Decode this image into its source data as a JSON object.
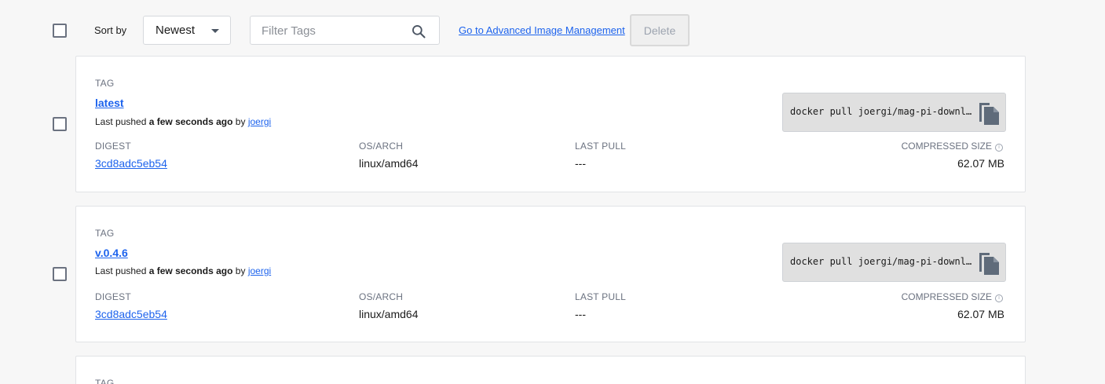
{
  "toolbar": {
    "sort_label": "Sort by",
    "sort_value": "Newest",
    "filter_placeholder": "Filter Tags",
    "advanced_link": "Go to Advanced Image Management",
    "delete_label": "Delete"
  },
  "labels": {
    "tag": "TAG",
    "digest": "DIGEST",
    "os_arch": "OS/ARCH",
    "last_pull": "LAST PULL",
    "compressed_size": "COMPRESSED SIZE",
    "last_pushed_prefix": "Last pushed",
    "by": "by",
    "info_glyph": "i"
  },
  "tags": [
    {
      "name": "latest",
      "pushed_when": "a few seconds ago",
      "pushed_by": "joergi",
      "digest": "3cd8adc5eb54",
      "os_arch": "linux/amd64",
      "last_pull": "---",
      "size": "62.07 MB",
      "pull_command": "docker pull joergi/mag-pi-downl…"
    },
    {
      "name": "v.0.4.6",
      "pushed_when": "a few seconds ago",
      "pushed_by": "joergi",
      "digest": "3cd8adc5eb54",
      "os_arch": "linux/amd64",
      "last_pull": "---",
      "size": "62.07 MB",
      "pull_command": "docker pull joergi/mag-pi-downl…"
    }
  ]
}
